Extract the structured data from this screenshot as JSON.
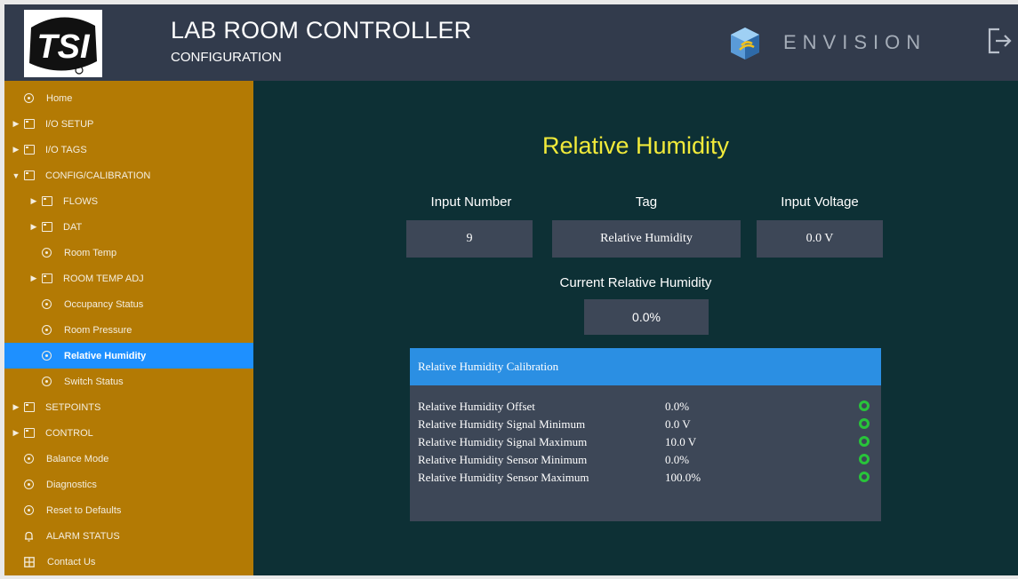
{
  "header": {
    "title": "LAB ROOM CONTROLLER",
    "subtitle": "CONFIGURATION",
    "brand": "ENVISION",
    "logo_text": "TSI",
    "colors": {
      "header_bg": "#323b4c",
      "sidebar_bg": "#b37a04",
      "main_bg": "#0d3035",
      "accent": "#f1ea3a",
      "active": "#1e90ff"
    }
  },
  "sidebar": {
    "items": [
      {
        "label": "Home",
        "icon": "circle-icon",
        "indent": 0,
        "caret": ""
      },
      {
        "label": "I/O SETUP",
        "icon": "folder-icon",
        "indent": 0,
        "caret": "▶"
      },
      {
        "label": "I/O TAGS",
        "icon": "folder-icon",
        "indent": 0,
        "caret": "▶"
      },
      {
        "label": "CONFIG/CALIBRATION",
        "icon": "folder-icon",
        "indent": 0,
        "caret": "▼"
      },
      {
        "label": "FLOWS",
        "icon": "folder-icon",
        "indent": 1,
        "caret": "▶"
      },
      {
        "label": "DAT",
        "icon": "folder-icon",
        "indent": 1,
        "caret": "▶"
      },
      {
        "label": "Room Temp",
        "icon": "circle-icon",
        "indent": 1,
        "caret": ""
      },
      {
        "label": "ROOM TEMP ADJ",
        "icon": "folder-icon",
        "indent": 1,
        "caret": "▶"
      },
      {
        "label": "Occupancy Status",
        "icon": "circle-icon",
        "indent": 1,
        "caret": ""
      },
      {
        "label": "Room Pressure",
        "icon": "circle-icon",
        "indent": 1,
        "caret": ""
      },
      {
        "label": "Relative Humidity",
        "icon": "circle-icon",
        "indent": 1,
        "caret": "",
        "active": true
      },
      {
        "label": "Switch Status",
        "icon": "circle-icon",
        "indent": 1,
        "caret": ""
      },
      {
        "label": "SETPOINTS",
        "icon": "folder-icon",
        "indent": 0,
        "caret": "▶"
      },
      {
        "label": "CONTROL",
        "icon": "folder-icon",
        "indent": 0,
        "caret": "▶"
      },
      {
        "label": "Balance Mode",
        "icon": "circle-icon",
        "indent": 0,
        "caret": ""
      },
      {
        "label": "Diagnostics",
        "icon": "circle-icon",
        "indent": 0,
        "caret": ""
      },
      {
        "label": "Reset to Defaults",
        "icon": "circle-icon",
        "indent": 0,
        "caret": ""
      },
      {
        "label": "ALARM STATUS",
        "icon": "bell-icon",
        "indent": 0,
        "caret": ""
      },
      {
        "label": "Contact Us",
        "icon": "contact-icon",
        "indent": 0,
        "caret": ""
      }
    ]
  },
  "main": {
    "title": "Relative Humidity",
    "input_number_label": "Input Number",
    "tag_label": "Tag",
    "input_voltage_label": "Input Voltage",
    "input_number": "9",
    "tag": "Relative Humidity",
    "input_voltage": "0.0 V",
    "current_label": "Current Relative Humidity",
    "current_value": "0.0%",
    "calibration": {
      "title": "Relative Humidity Calibration",
      "rows": [
        {
          "name": "Relative Humidity Offset",
          "value": "0.0%"
        },
        {
          "name": "Relative Humidity Signal Minimum",
          "value": "0.0 V"
        },
        {
          "name": "Relative Humidity Signal Maximum",
          "value": "10.0 V"
        },
        {
          "name": "Relative Humidity Sensor Minimum",
          "value": "0.0%"
        },
        {
          "name": "Relative Humidity Sensor Maximum",
          "value": "100.0%"
        }
      ]
    }
  }
}
